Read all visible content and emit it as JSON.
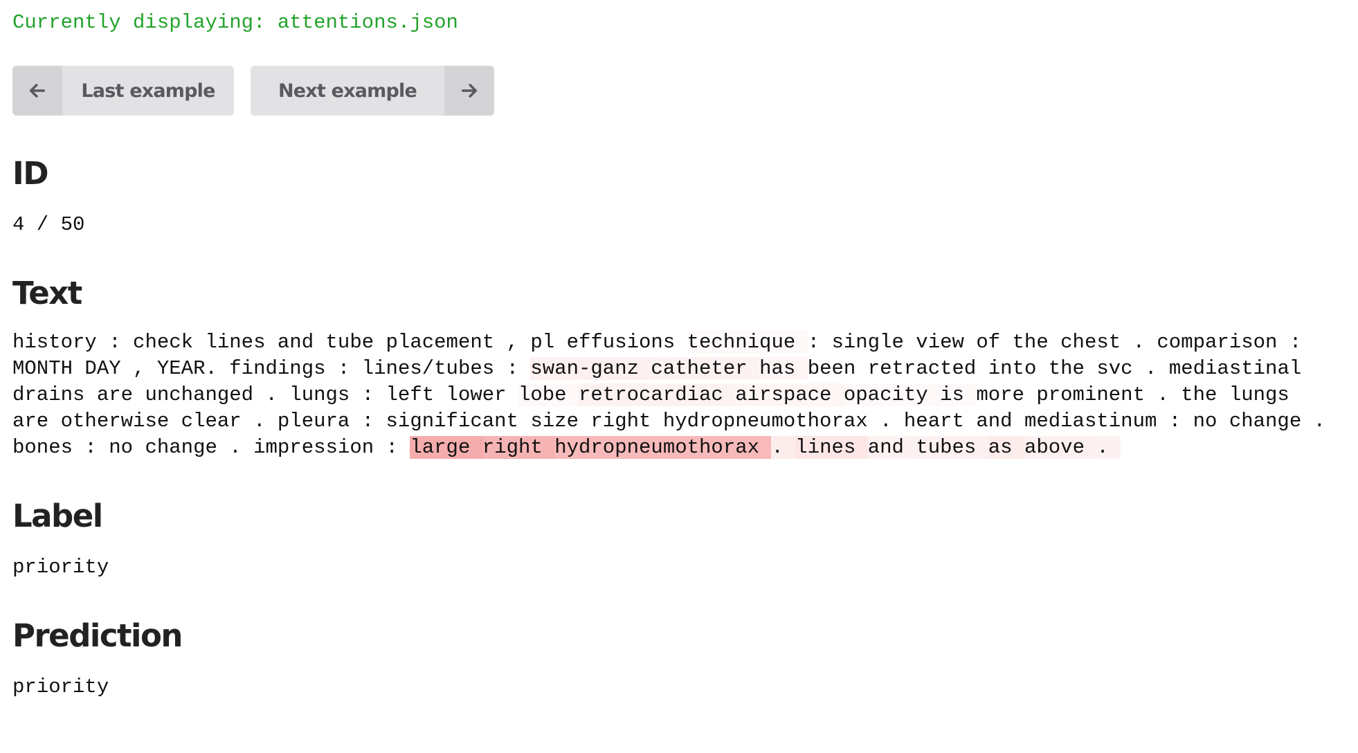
{
  "status": "Currently displaying: attentions.json",
  "nav": {
    "prev_label": "Last example",
    "next_label": "Next example",
    "prev_icon": "arrow-left-icon",
    "next_icon": "arrow-right-icon"
  },
  "sections": {
    "id_title": "ID",
    "id_value": "4 / 50",
    "text_title": "Text",
    "label_title": "Label",
    "label_value": "priority",
    "prediction_title": "Prediction",
    "prediction_value": "priority"
  },
  "colors": {
    "status_text": "#22a32a",
    "highlight_base": "#f08080",
    "button_bg": "#e2e2e4",
    "button_icon_bg": "#d4d4d6"
  },
  "tokens": [
    {
      "t": "history",
      "w": 0
    },
    {
      "t": ":",
      "w": 0
    },
    {
      "t": "check",
      "w": 0
    },
    {
      "t": "lines",
      "w": 0
    },
    {
      "t": "and",
      "w": 0
    },
    {
      "t": "tube",
      "w": 0
    },
    {
      "t": "placement",
      "w": 0
    },
    {
      "t": ",",
      "w": 0
    },
    {
      "t": "pl",
      "w": 0
    },
    {
      "t": "effusions",
      "w": 0
    },
    {
      "t": "technique",
      "w": 0.05
    },
    {
      "t": ":",
      "w": 0
    },
    {
      "t": "single",
      "w": 0
    },
    {
      "t": "view",
      "w": 0
    },
    {
      "t": "of",
      "w": 0
    },
    {
      "t": "the",
      "w": 0
    },
    {
      "t": "chest",
      "w": 0
    },
    {
      "t": ".",
      "w": 0
    },
    {
      "t": "comparison",
      "w": 0
    },
    {
      "t": ":",
      "w": 0
    },
    {
      "t": "MONTH",
      "w": 0
    },
    {
      "t": "DAY",
      "w": 0
    },
    {
      "t": ",",
      "w": 0
    },
    {
      "t": "YEAR.",
      "w": 0
    },
    {
      "t": "findings",
      "w": 0
    },
    {
      "t": ":",
      "w": 0
    },
    {
      "t": "lines/tubes",
      "w": 0
    },
    {
      "t": ":",
      "w": 0
    },
    {
      "t": "swan-ganz",
      "w": 0.12
    },
    {
      "t": "catheter",
      "w": 0.1
    },
    {
      "t": "has",
      "w": 0.08
    },
    {
      "t": "been",
      "w": 0
    },
    {
      "t": "retracted",
      "w": 0
    },
    {
      "t": "into",
      "w": 0
    },
    {
      "t": "the",
      "w": 0
    },
    {
      "t": "svc",
      "w": 0
    },
    {
      "t": ".",
      "w": 0
    },
    {
      "t": "mediastinal",
      "w": 0
    },
    {
      "t": "drains",
      "w": 0
    },
    {
      "t": "are",
      "w": 0
    },
    {
      "t": "unchanged",
      "w": 0
    },
    {
      "t": ".",
      "w": 0
    },
    {
      "t": "lungs",
      "w": 0
    },
    {
      "t": ":",
      "w": 0
    },
    {
      "t": "left",
      "w": 0
    },
    {
      "t": "lower",
      "w": 0
    },
    {
      "t": "lobe",
      "w": 0.06
    },
    {
      "t": "retrocardiac",
      "w": 0.1
    },
    {
      "t": "airspace",
      "w": 0.08
    },
    {
      "t": "opacity",
      "w": 0.06
    },
    {
      "t": "is",
      "w": 0.05
    },
    {
      "t": "more",
      "w": 0
    },
    {
      "t": "prominent",
      "w": 0
    },
    {
      "t": ".",
      "w": 0
    },
    {
      "t": "the",
      "w": 0
    },
    {
      "t": "lungs",
      "w": 0
    },
    {
      "t": "are",
      "w": 0
    },
    {
      "t": "otherwise",
      "w": 0
    },
    {
      "t": "clear",
      "w": 0
    },
    {
      "t": ".",
      "w": 0
    },
    {
      "t": "pleura",
      "w": 0
    },
    {
      "t": ":",
      "w": 0
    },
    {
      "t": "significant",
      "w": 0
    },
    {
      "t": "size",
      "w": 0
    },
    {
      "t": "right",
      "w": 0
    },
    {
      "t": "hydropneumothorax",
      "w": 0
    },
    {
      "t": ".",
      "w": 0
    },
    {
      "t": "heart",
      "w": 0
    },
    {
      "t": "and",
      "w": 0
    },
    {
      "t": "mediastinum",
      "w": 0
    },
    {
      "t": ":",
      "w": 0
    },
    {
      "t": "no",
      "w": 0
    },
    {
      "t": "change",
      "w": 0
    },
    {
      "t": ".",
      "w": 0
    },
    {
      "t": "bones",
      "w": 0
    },
    {
      "t": ":",
      "w": 0
    },
    {
      "t": "no",
      "w": 0
    },
    {
      "t": "change",
      "w": 0
    },
    {
      "t": ".",
      "w": 0
    },
    {
      "t": "impression",
      "w": 0
    },
    {
      "t": ":",
      "w": 0
    },
    {
      "t": "large",
      "w": 0.65
    },
    {
      "t": "right",
      "w": 0.6
    },
    {
      "t": "hydropneumothorax",
      "w": 0.55
    },
    {
      "t": ".",
      "w": 0.15
    },
    {
      "t": "lines",
      "w": 0.2
    },
    {
      "t": "and",
      "w": 0.1
    },
    {
      "t": "tubes",
      "w": 0.12
    },
    {
      "t": "as",
      "w": 0.15
    },
    {
      "t": "above",
      "w": 0.12
    },
    {
      "t": ".",
      "w": 0.1
    }
  ]
}
